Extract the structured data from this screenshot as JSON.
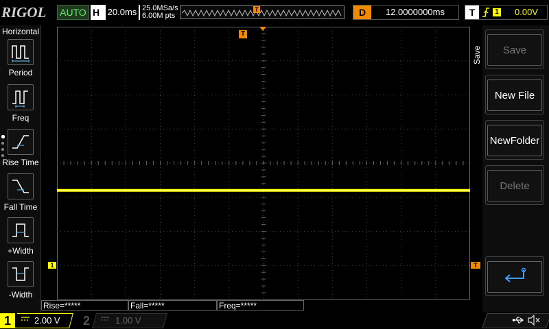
{
  "header": {
    "brand": "RIGOL",
    "auto_label": "AUTO",
    "horizontal_label": "H",
    "timebase": "20.0ms",
    "sample_rate": "25.0MSa/s",
    "memory_depth": "6.00M pts",
    "memory_trigger_marker": "T",
    "delay_label": "D",
    "delay_value": "12.0000000ms",
    "trigger_label": "T",
    "trigger_slope": "rising-edge-icon",
    "trigger_source": "1",
    "trigger_level": "0.00V"
  },
  "left_menu": {
    "title": "Horizontal",
    "items": [
      {
        "label": "Period",
        "icon": "period-icon"
      },
      {
        "label": "Freq",
        "icon": "frequency-icon"
      },
      {
        "label": "Rise Time",
        "icon": "rise-time-icon"
      },
      {
        "label": "Fall Time",
        "icon": "fall-time-icon"
      },
      {
        "label": "+Width",
        "icon": "positive-width-icon"
      },
      {
        "label": "-Width",
        "icon": "negative-width-icon"
      }
    ]
  },
  "screen": {
    "trigger_position_marker": "T",
    "channel1_marker": "1",
    "trigger_level_marker": "T",
    "trace_color": "#ffff00",
    "trace_level_divisions_from_top": 4.8
  },
  "right_menu": {
    "title": "Save",
    "buttons": [
      {
        "label": "Save",
        "enabled": false
      },
      {
        "label": "New File",
        "enabled": true
      },
      {
        "label": "NewFolder",
        "enabled": true
      },
      {
        "label": "Delete",
        "enabled": false
      },
      {
        "label": "",
        "icon": "return-arrow-icon",
        "enabled": true
      }
    ]
  },
  "measurements": [
    {
      "label": "Rise=*****"
    },
    {
      "label": "Fall=*****"
    },
    {
      "label": "Freq=*****"
    }
  ],
  "channels": [
    {
      "number": "1",
      "coupling": "DC",
      "scale": "2.00 V",
      "color": "#ffff00",
      "active": true
    },
    {
      "number": "2",
      "coupling": "DC",
      "scale": "1.00 V",
      "color": "#555555",
      "active": false
    }
  ],
  "status": {
    "usb_icon": "usb-icon",
    "sound_icon": "speaker-muted-icon"
  }
}
